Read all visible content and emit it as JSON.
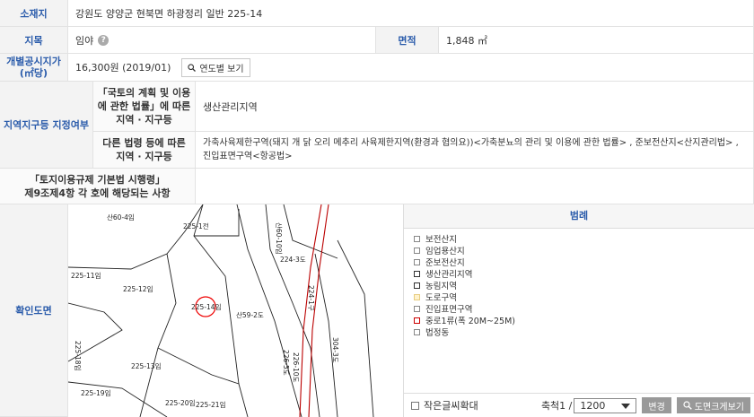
{
  "rows": {
    "location": {
      "label": "소재지",
      "value": "강원도 양양군 현북면 하광정리 일반 225-14"
    },
    "land_category": {
      "label": "지목",
      "value": "임야"
    },
    "area": {
      "label": "면적",
      "value": "1,848 ㎡"
    },
    "price": {
      "label_line1": "개별공시지가",
      "label_line2": "(㎡당)",
      "value": "16,300원 (2019/01)",
      "button": "연도별 보기"
    },
    "zone": {
      "label": "지역지구등 지정여부",
      "sub1_label": "「국토의 계획 및 이용에 관한 법률」에 따른 지역 · 지구등",
      "sub1_value": "생산관리지역",
      "sub2_label": "다른 법령 등에 따른 지역 · 지구등",
      "sub2_value_line1": "가축사육제한구역(돼지 개 닭 오리 메추리 사육제한지역(환경과 협의요))<가축분뇨의 관리 및 이용에 관한 법률> , 준보전산지<산지관리법> ,",
      "sub2_value_line2": "진입표면구역<항공법>"
    },
    "regulation": {
      "label_line1": "「토지이용규제 기본법 시행령」",
      "label_line2": "제9조제4항 각 호에 해당되는 사항",
      "value": ""
    },
    "map": {
      "label": "확인도면"
    }
  },
  "map_labels": [
    {
      "t": "산60-4임"
    },
    {
      "t": "225-1전"
    },
    {
      "t": "산60-10임"
    },
    {
      "t": "224-3도"
    },
    {
      "t": "225-11임"
    },
    {
      "t": "225-12임"
    },
    {
      "t": "225-14임"
    },
    {
      "t": "산59-2도"
    },
    {
      "t": "224-1구"
    },
    {
      "t": "225-18임"
    },
    {
      "t": "225-13임"
    },
    {
      "t": "226-5도"
    },
    {
      "t": "226-10도"
    },
    {
      "t": "304-3도"
    },
    {
      "t": "225-19임"
    },
    {
      "t": "225-20임"
    },
    {
      "t": "225-21임"
    }
  ],
  "legend": {
    "title": "범례",
    "items": [
      {
        "label": "보전산지",
        "color": "#ffffff"
      },
      {
        "label": "임업용산지",
        "color": "#ffffff"
      },
      {
        "label": "준보전산지",
        "color": "#ffffff"
      },
      {
        "label": "생산관리지역",
        "color": "#ffffff"
      },
      {
        "label": "농림지역",
        "color": "#ffffff"
      },
      {
        "label": "도로구역",
        "color": "#fff2cc"
      },
      {
        "label": "진입표면구역",
        "color": "#ffffff"
      },
      {
        "label": "중로1류(폭 20M~25M)",
        "color": "#ffffff"
      },
      {
        "label": "법정동",
        "color": "#ffffff"
      }
    ]
  },
  "controls": {
    "enlarge_text": "작은글씨확대",
    "scale_label": "축척1 /",
    "scale_value": "1200",
    "change_button": "변경",
    "enlarge_map_button": "도면크게보기"
  }
}
